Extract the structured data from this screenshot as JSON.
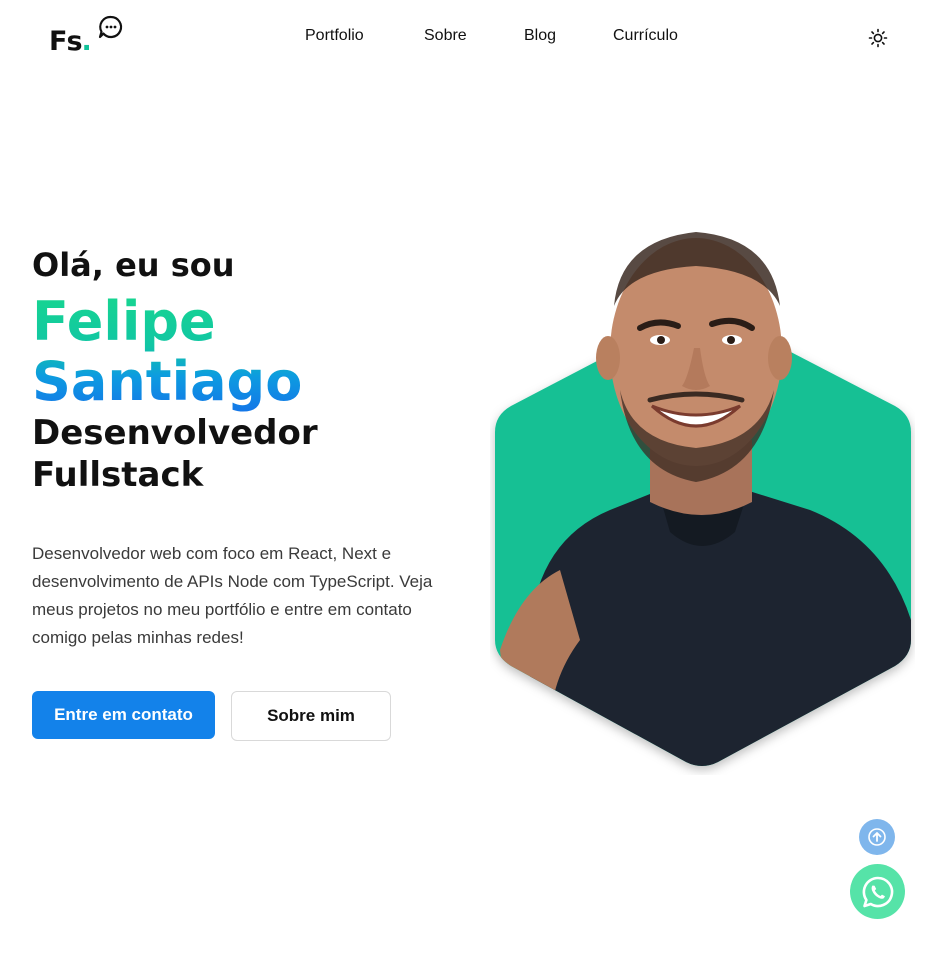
{
  "header": {
    "logo_text": "Fs",
    "logo_dot": ".",
    "nav": [
      {
        "label": "Portfolio"
      },
      {
        "label": "Sobre"
      },
      {
        "label": "Blog"
      },
      {
        "label": "Currículo"
      }
    ],
    "theme_icon": "sun-icon"
  },
  "hero": {
    "greeting": "Olá, eu sou",
    "first_name": "Felipe",
    "last_name": "Santiago",
    "role_line1": "Desenvolvedor",
    "role_line2": "Fullstack",
    "description": "Desenvolvedor web com foco em React, Next e desenvolvimento de APIs Node com TypeScript. Veja meus projetos no meu portfólio e entre em contato comigo pelas minhas redes!",
    "primary_button": "Entre em contato",
    "secondary_button": "Sobre mim"
  },
  "floating": {
    "scroll_top_icon": "arrow-up-icon",
    "whatsapp_icon": "whatsapp-icon"
  },
  "colors": {
    "accent_green": "#12c39a",
    "accent_blue": "#1382ea",
    "hexagon": "#17c094"
  }
}
